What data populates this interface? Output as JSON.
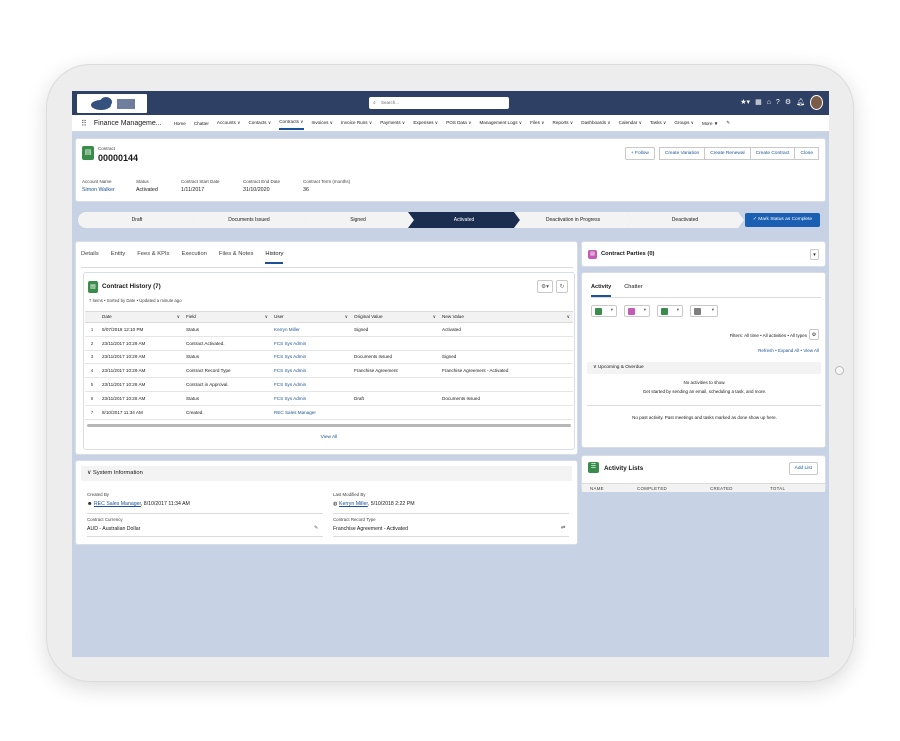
{
  "header": {
    "search_placeholder": "Search...",
    "icons": [
      "favorites-icon",
      "grid-icon",
      "bell-outline-icon",
      "help-icon",
      "gear-icon",
      "notification-icon",
      "avatar"
    ]
  },
  "nav": {
    "app_name": "Finance Manageme...",
    "items": [
      "Home",
      "Chatter",
      "Accounts ∨",
      "Contacts ∨",
      "Contracts ∨",
      "Invoices ∨",
      "Invoice Runs ∨",
      "Payments ∨",
      "Expenses ∨",
      "POS Data ∨",
      "Management Logs ∨",
      "Files ∨",
      "Reports ∨",
      "Dashboards ∨",
      "Calendar ∨",
      "Tasks ∨",
      "Groups ∨",
      "More ▼"
    ],
    "active_index": 4
  },
  "record": {
    "type": "Contract",
    "number": "00000144",
    "buttons": [
      "+ Follow",
      "Create Variation",
      "Create Renewal",
      "Create Contract",
      "Clone"
    ],
    "fields": [
      {
        "label": "Account Name",
        "value": "Simon Walker",
        "link": true
      },
      {
        "label": "Status",
        "value": "Activated",
        "link": false
      },
      {
        "label": "Contract Start Date",
        "value": "1/11/2017",
        "link": false
      },
      {
        "label": "Contract End Date",
        "value": "31/10/2020",
        "link": false
      },
      {
        "label": "Contract Term (months)",
        "value": "36",
        "link": false
      }
    ]
  },
  "path": {
    "stages": [
      "Draft",
      "Documents Issued",
      "Signed",
      "Activated",
      "Deactivation in Progress",
      "Deactivated"
    ],
    "active_index": 3,
    "mark_button": "✓ Mark Status as Complete"
  },
  "tabs": {
    "items": [
      "Details",
      "Entity",
      "Fees & KPIs",
      "Execution",
      "Files & Notes",
      "History"
    ],
    "active_index": 5
  },
  "history": {
    "title": "Contract History (7)",
    "subtitle": "7 items • Sorted by Date • Updated a minute ago",
    "columns": [
      "Date",
      "Field",
      "User",
      "Original Value",
      "New Value"
    ],
    "rows": [
      [
        "1",
        "5/07/2018 12:10 PM",
        "Status",
        "Kerryn Miller",
        "Signed",
        "Activated"
      ],
      [
        "2",
        "23/11/2017 10:29 AM",
        "Contract Activated.",
        "FCS Sys Admin",
        "",
        ""
      ],
      [
        "3",
        "23/11/2017 10:29 AM",
        "Status",
        "FCS Sys Admin",
        "Documents Issued",
        "Signed"
      ],
      [
        "4",
        "23/11/2017 10:29 AM",
        "Contract Record Type",
        "FCS Sys Admin",
        "Franchise Agreement",
        "Franchise Agreement - Activated"
      ],
      [
        "5",
        "23/11/2017 10:28 AM",
        "Contract in Approval.",
        "FCS Sys Admin",
        "",
        ""
      ],
      [
        "6",
        "23/11/2017 10:28 AM",
        "Status",
        "FCS Sys Admin",
        "Draft",
        "Documents Issued"
      ],
      [
        "7",
        "8/10/2017 11:34 AM",
        "Created.",
        "REC Sales Manager",
        "",
        ""
      ]
    ],
    "view_all": "View All"
  },
  "system_info": {
    "title": "System Information",
    "created_by_label": "Created By",
    "created_by_user": "REC Sales Manager",
    "created_by_date": ", 8/10/2017 11:34 AM",
    "modified_by_label": "Last Modified By",
    "modified_by_user": "Kerryn Miller",
    "modified_by_date": ", 5/10/2018 2:22 PM",
    "currency_label": "Contract Currency",
    "currency_value": "AUD - Australian Dollar",
    "record_type_label": "Contract Record Type",
    "record_type_value": "Franchise Agreement - Activated"
  },
  "parties": {
    "title": "Contract Parties (0)"
  },
  "activity": {
    "tabs": [
      "Activity",
      "Chatter"
    ],
    "filters": "Filters: All time • All activities • All types",
    "links": "Refresh  •  Expand All  •  View All",
    "upcoming_title": "Upcoming & Overdue",
    "no_activities": "No activities to show.",
    "get_started": "Get started by sending an email, scheduling a task, and more.",
    "no_past": "No past activity. Past meetings and tasks marked as done show up here."
  },
  "activity_lists": {
    "title": "Activity Lists",
    "add_button": "Add List",
    "columns": [
      "NAME",
      "COMPLETED",
      "CREATED",
      "TOTAL"
    ]
  },
  "colors": {
    "header": "#2e4164",
    "accent": "#1b5297",
    "active_stage": "#1c2e4f",
    "green_icon": "#3a8c4a",
    "pink_icon": "#c45ab3",
    "grey_icon": "#7e7e7e"
  }
}
